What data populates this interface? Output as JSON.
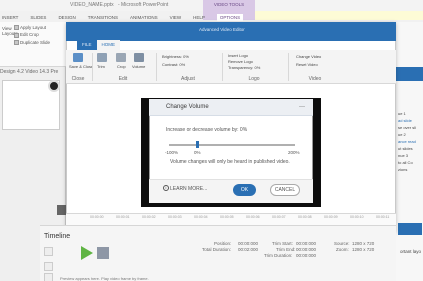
{
  "ppt": {
    "title_left": "VIDEO_NAME.pptx",
    "title_right": "- Microsoft PowerPoint",
    "context_tab": "VIDEO TOOLS",
    "tabs": [
      "INSERT",
      "SLIDES",
      "DESIGN",
      "TRANSITIONS",
      "ANIMATIONS",
      "VIEW",
      "HELP",
      "OPTIONS"
    ],
    "clipboard": [
      "Apply Layout",
      "Edit Crop",
      "Duplicate Slide"
    ],
    "clipboard_small": [
      "View",
      "Layouts"
    ],
    "left_label": "Design  4.2 Video  14.3 Pre",
    "right_text": [
      "ue 1",
      "ad slide",
      "se over sli",
      "ue 2",
      "ance read",
      "ut slides",
      "nue 3",
      "to all Co",
      "zions"
    ],
    "right_bottom": "ortant layo",
    "right_bottom2": "elements"
  },
  "editor": {
    "title": "Advanced Video Editor",
    "tabs": [
      "FILE",
      "HOME"
    ],
    "ribbon": {
      "groups": [
        {
          "label": "Close",
          "buttons": [
            "Save & Close"
          ]
        },
        {
          "label": "Edit",
          "buttons": [
            "Trim",
            "Crop",
            "Volume"
          ]
        },
        {
          "label": "Adjust",
          "buttons": [
            "Brightness: 0%",
            "Contrast: 0%"
          ]
        },
        {
          "label": "Logo",
          "buttons": [
            "Insert Logo",
            "Remove Logo",
            "Transparency: 0%"
          ]
        },
        {
          "label": "Video",
          "buttons": [
            "Change Video",
            "Reset Video"
          ]
        }
      ]
    }
  },
  "dialog": {
    "title": "Change Volume",
    "text": "Increase or decrease volume by: 0%",
    "min_label": "-100%",
    "mid_label": "0%",
    "max_label": "200%",
    "note": "Volume changes will only be heard in published video.",
    "learn_more": "LEARN MORE...",
    "ok": "OK",
    "cancel": "CANCEL",
    "volume_value": 0,
    "volume_min": -100,
    "volume_max": 200
  },
  "ruler": [
    "00:00:00",
    "00:00:01",
    "00:00:02",
    "00:00:03",
    "00:00:04",
    "00:00:05",
    "00:00:06",
    "00:00:07",
    "00:00:08",
    "00:00:09",
    "00:00:10",
    "00:00:11"
  ],
  "bottom": {
    "timeline_label": "Timeline",
    "position_label": "Position:",
    "position_value": "00:00:000",
    "total_label": "Total Duration:",
    "total_value": "00:02:000",
    "trim_start_label": "Trim Start:",
    "trim_start_value": "00:00:000",
    "trim_end_label": "Trim End:",
    "trim_end_value": "00:00:000",
    "trim_duration_label": "Trim Duration:",
    "trim_duration_value": "00:00:000",
    "source_label": "Source:",
    "source_value": "1280 x 720",
    "zoom_label": "Zoom:",
    "zoom_value": "1280 x 720",
    "status": "Preview appears here. Play video frame by frame."
  },
  "colors": {
    "accent": "#2a6fb3",
    "play": "#5fb443",
    "video_tools": "#d9c8e6"
  }
}
